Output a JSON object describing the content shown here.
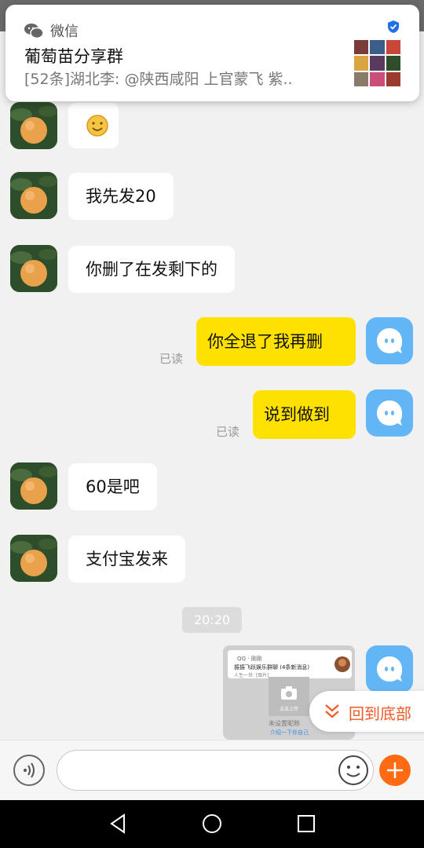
{
  "notification": {
    "app_name": "微信",
    "title": "葡萄苗分享群",
    "message": "[52条]湖北李: @陕西咸阳     上官蒙飞 紫..",
    "icon": "wechat-icon",
    "verify_icon": "shield-check-icon"
  },
  "messages": [
    {
      "side": "left",
      "type": "emoji",
      "content": "smile-emoji"
    },
    {
      "side": "left",
      "text": "我先发20"
    },
    {
      "side": "left",
      "text": "你删了在发剩下的"
    },
    {
      "side": "right",
      "text": "你全退了我再删",
      "status": "已读"
    },
    {
      "side": "right",
      "text": "说到做到",
      "status": "已读"
    },
    {
      "side": "left",
      "text": "60是吧"
    },
    {
      "side": "left",
      "text": "支付宝发来"
    }
  ],
  "timestamp": "20:20",
  "screenshot_message": {
    "line1": "QQ · 刚刚",
    "line2": "振振飞跃娱乐群聊 (4条新消息)",
    "line3": "人生一世: [图片]",
    "upload_label": "点击上传",
    "nickname_hint": "未设置昵称",
    "intro_hint": "介绍一下你自己"
  },
  "back_to_bottom": "回到底部",
  "input": {
    "value": "",
    "placeholder": ""
  },
  "colors": {
    "accent": "#ff6a13",
    "my_bubble": "#ffe100",
    "back_bottom_text": "#f05a28",
    "my_avatar": "#63b6f5"
  }
}
